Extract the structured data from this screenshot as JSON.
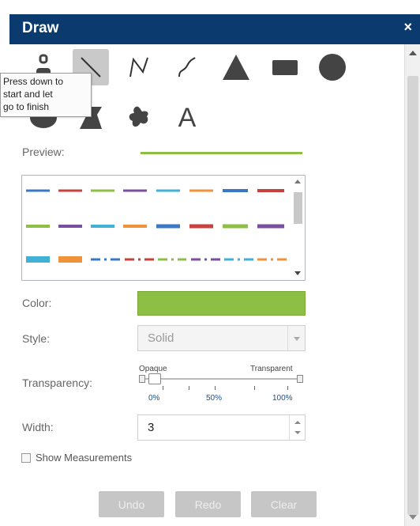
{
  "window": {
    "title": "Draw",
    "close_glyph": "×"
  },
  "tools": [
    {
      "name": "point-tool",
      "icon": "point-icon"
    },
    {
      "name": "line-tool",
      "icon": "line-icon",
      "selected": true
    },
    {
      "name": "polyline-tool",
      "icon": "polyline-icon"
    },
    {
      "name": "freehand-line-tool",
      "icon": "freehand-line-icon"
    },
    {
      "name": "triangle-tool",
      "icon": "triangle-icon"
    },
    {
      "name": "rectangle-tool",
      "icon": "rectangle-icon"
    },
    {
      "name": "circle-tool",
      "icon": "circle-icon"
    },
    {
      "name": "ellipse-tool",
      "icon": "ellipse-icon"
    },
    {
      "name": "polygon-tool",
      "icon": "polygon-icon"
    },
    {
      "name": "freehand-polygon-tool",
      "icon": "freehand-polygon-icon"
    },
    {
      "name": "text-tool",
      "icon": "text-icon",
      "glyph": "A"
    }
  ],
  "tooltip": {
    "line1": "Press down to",
    "line2": "start and let",
    "line3": "go to finish"
  },
  "preview": {
    "label": "Preview:",
    "color": "#8cbf44"
  },
  "line_patterns_colors": [
    "#3a78c3",
    "#c9413d",
    "#8cbf44",
    "#7b4fa0",
    "#41b2d5",
    "#f0923a"
  ],
  "color": {
    "label": "Color:",
    "value": "#8cbf44"
  },
  "style": {
    "label": "Style:",
    "value": "Solid"
  },
  "transparency": {
    "label": "Transparency:",
    "left_caption": "Opaque",
    "right_caption": "Transparent",
    "ticks": [
      "0%",
      "50%",
      "100%"
    ],
    "value_fraction": 0
  },
  "width": {
    "label": "Width:",
    "value": "3"
  },
  "measurements": {
    "label": "Show Measurements",
    "checked": false
  },
  "buttons": {
    "undo": "Undo",
    "redo": "Redo",
    "clear": "Clear"
  }
}
